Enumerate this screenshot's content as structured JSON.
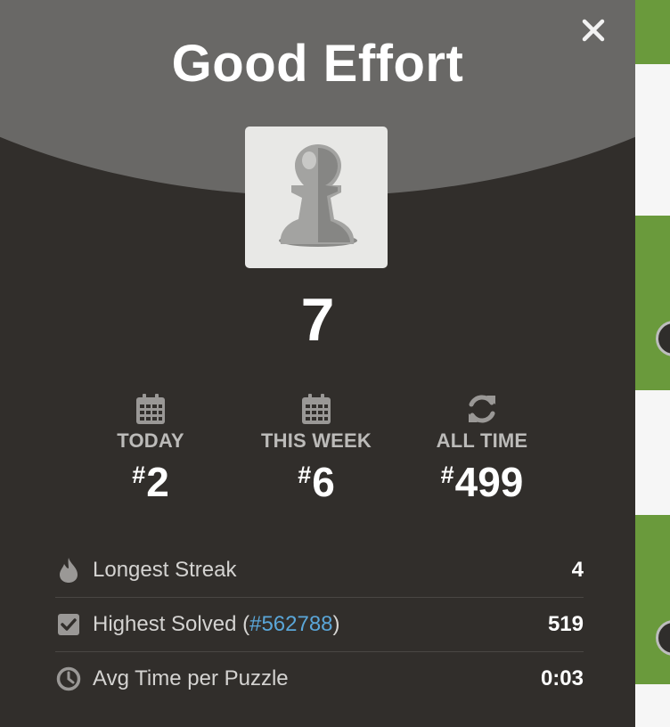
{
  "modal": {
    "title": "Good Effort",
    "score": "7",
    "ranks": [
      {
        "label": "TODAY",
        "hash": "#",
        "value": "2",
        "icon": "calendar-icon"
      },
      {
        "label": "THIS WEEK",
        "hash": "#",
        "value": "6",
        "icon": "calendar-icon"
      },
      {
        "label": "ALL TIME",
        "hash": "#",
        "value": "499",
        "icon": "refresh-icon"
      }
    ],
    "stats": [
      {
        "label": "Longest Streak",
        "value": "4",
        "icon": "flame-icon"
      },
      {
        "label_prefix": "Highest Solved (",
        "link": "#562788",
        "label_suffix": ")",
        "value": "519",
        "icon": "checkbox-icon"
      },
      {
        "label": "Avg Time per Puzzle",
        "value": "0:03",
        "icon": "clock-icon"
      }
    ]
  },
  "colors": {
    "modal_bg": "#312e2b",
    "header_bg": "#696866",
    "link": "#5aa6d8",
    "board_green": "#6a9a3c"
  }
}
